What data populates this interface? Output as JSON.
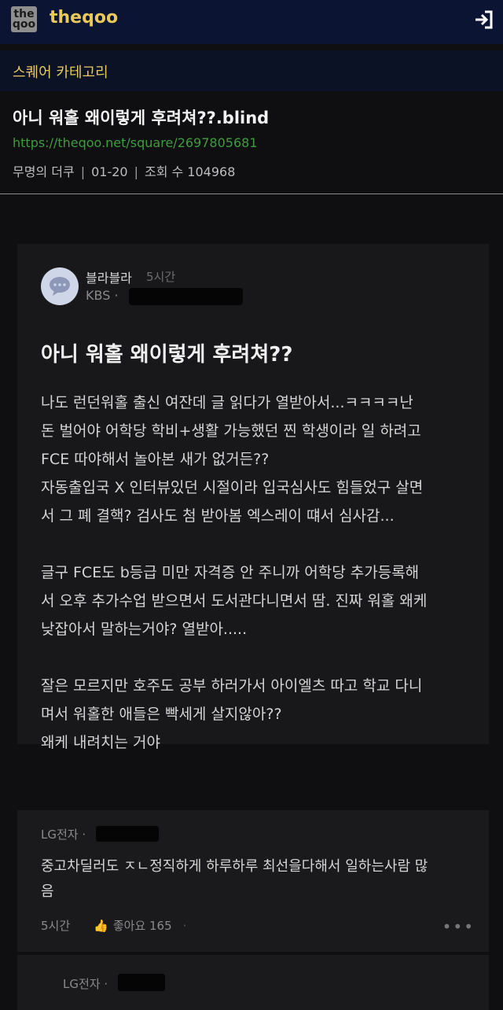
{
  "header": {
    "logo_top": "the",
    "logo_bottom": "qoo",
    "brand": "theqoo",
    "login_icon": "login-icon"
  },
  "category": {
    "label": "스퀘어 카테고리"
  },
  "post": {
    "title": "아니 워홀 왜이렇게 후려쳐??.blind",
    "url": "https://theqoo.net/square/2697805681",
    "author": "무명의 더쿠",
    "date": "01-20",
    "views_label": "조회 수 104968"
  },
  "blind_post": {
    "author": "블라블라",
    "time": "5시간",
    "org": "KBS ·",
    "title": "아니 워홀 왜이렇게 후려쳐??",
    "lines": [
      "나도 런던워홀 출신 여잔데 글 읽다가 열받아서...ㅋㅋㅋㅋ난",
      "돈 벌어야 어학당 학비+생활 가능했던 찐 학생이라 일 하려고",
      "FCE 따야해서 놀아본 새가 없거든??",
      "자동출입국 X 인터뷰있던 시절이라 입국심사도 힘들었구 살면",
      "서 그 폐 결핵? 검사도 첨 받아봄 엑스레이 떄서 심사감...",
      "",
      "글구 FCE도 b등급 미만 자격증 안 주니까 어학당 추가등록해",
      "서 오후 추가수업 받으면서 도서관다니면서 땀. 진짜 워홀 왜케",
      "낮잡아서 말하는거야? 열받아.....",
      "",
      "잘은 모르지만 호주도 공부 하러가서 아이엘츠 따고 학교 다니",
      "며서 워홀한 애들은 빡세게 살지않아??",
      "왜케 내려치는 거야"
    ]
  },
  "comments": [
    {
      "org": "LG전자 ·",
      "lines": [
        "중고차딜러도 ㅈㄴ정직하게 하루하루 최선을다해서 일하는사람 많",
        "음"
      ],
      "time": "5시간",
      "like_label": "좋아요 165"
    },
    {
      "org": "LG전자 ·"
    }
  ]
}
